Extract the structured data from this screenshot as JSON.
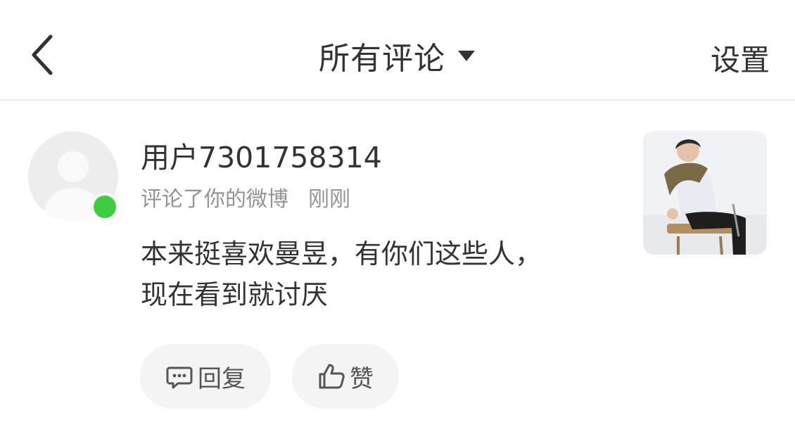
{
  "header": {
    "back_icon": "chevron-left-icon",
    "title": "所有评论",
    "title_dropdown_icon": "caret-down-icon",
    "settings_label": "设置"
  },
  "comment_item": {
    "avatar_icon": "default-user-avatar",
    "online_status_color": "#3ccd40",
    "username": "用户7301758314",
    "action_text": "评论了你的微博",
    "time": "刚刚",
    "content_line1": "本来挺喜欢曼昱，有你们这些人，",
    "content_line2": "现在看到就讨厌",
    "thumbnail": "post-thumbnail-photo",
    "reply_label": "回复",
    "reply_icon": "comment-icon",
    "like_label": "赞",
    "like_icon": "thumbs-up-icon"
  }
}
